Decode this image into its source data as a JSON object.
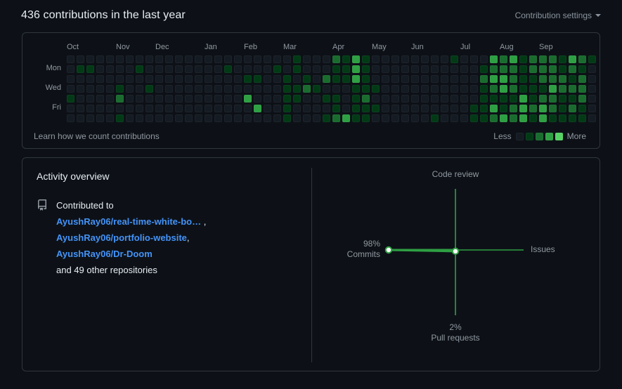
{
  "header": {
    "title": "436 contributions in the last year",
    "settings_label": "Contribution settings",
    "caret_icon": "chevron-down-icon"
  },
  "graph": {
    "months": [
      "Oct",
      "Nov",
      "Dec",
      "Jan",
      "Feb",
      "Mar",
      "Apr",
      "May",
      "Jun",
      "Jul",
      "Aug",
      "Sep"
    ],
    "month_week_index": [
      0,
      5,
      9,
      14,
      18,
      22,
      27,
      31,
      35,
      40,
      44,
      48
    ],
    "day_labels": [
      {
        "label": "Mon",
        "row": 1
      },
      {
        "label": "Wed",
        "row": 3
      },
      {
        "label": "Fri",
        "row": 5
      }
    ],
    "learn_link": "Learn how we count contributions",
    "legend": {
      "less": "Less",
      "more": "More",
      "colors": [
        "#151b23",
        "#033a16",
        "#196c2e",
        "#2ea043",
        "#56d364"
      ]
    },
    "palette": [
      "#151b23",
      "#033a16",
      "#196c2e",
      "#2ea043",
      "#56d364"
    ],
    "weeks": [
      [
        0,
        0,
        0,
        0,
        1,
        0,
        0
      ],
      [
        0,
        1,
        0,
        0,
        0,
        0,
        0
      ],
      [
        0,
        1,
        0,
        0,
        0,
        0,
        0
      ],
      [
        0,
        0,
        0,
        0,
        0,
        0,
        0
      ],
      [
        0,
        0,
        0,
        0,
        0,
        0,
        0
      ],
      [
        0,
        0,
        0,
        1,
        2,
        0,
        1
      ],
      [
        0,
        0,
        0,
        0,
        0,
        0,
        0
      ],
      [
        0,
        1,
        0,
        0,
        0,
        0,
        0
      ],
      [
        0,
        0,
        0,
        1,
        0,
        0,
        0
      ],
      [
        0,
        0,
        0,
        0,
        0,
        0,
        0
      ],
      [
        0,
        0,
        0,
        0,
        0,
        0,
        0
      ],
      [
        0,
        0,
        0,
        0,
        0,
        0,
        0
      ],
      [
        0,
        0,
        0,
        0,
        0,
        0,
        0
      ],
      [
        0,
        0,
        0,
        0,
        0,
        0,
        0
      ],
      [
        0,
        0,
        0,
        0,
        0,
        0,
        0
      ],
      [
        0,
        0,
        0,
        0,
        0,
        0,
        0
      ],
      [
        0,
        1,
        0,
        0,
        0,
        0,
        0
      ],
      [
        0,
        0,
        0,
        0,
        0,
        0,
        0
      ],
      [
        0,
        0,
        1,
        0,
        3,
        0,
        0
      ],
      [
        0,
        0,
        1,
        0,
        0,
        3,
        0
      ],
      [
        0,
        0,
        0,
        0,
        0,
        0,
        0
      ],
      [
        0,
        1,
        0,
        0,
        0,
        0,
        0
      ],
      [
        0,
        0,
        1,
        1,
        1,
        1,
        1
      ],
      [
        1,
        1,
        0,
        1,
        1,
        0,
        0
      ],
      [
        0,
        0,
        1,
        2,
        0,
        0,
        0
      ],
      [
        0,
        0,
        0,
        1,
        0,
        0,
        0
      ],
      [
        0,
        0,
        2,
        0,
        1,
        0,
        1
      ],
      [
        2,
        1,
        1,
        0,
        1,
        1,
        2
      ],
      [
        1,
        1,
        1,
        0,
        0,
        0,
        3
      ],
      [
        3,
        3,
        3,
        1,
        1,
        1,
        1
      ],
      [
        1,
        1,
        1,
        1,
        2,
        1,
        1
      ],
      [
        0,
        0,
        0,
        1,
        0,
        1,
        0
      ],
      [
        0,
        0,
        0,
        0,
        0,
        0,
        0
      ],
      [
        0,
        0,
        0,
        0,
        0,
        0,
        0
      ],
      [
        0,
        0,
        0,
        0,
        0,
        0,
        0
      ],
      [
        0,
        0,
        0,
        0,
        0,
        0,
        0
      ],
      [
        0,
        0,
        0,
        0,
        0,
        0,
        0
      ],
      [
        0,
        0,
        0,
        0,
        0,
        0,
        1
      ],
      [
        0,
        0,
        0,
        0,
        0,
        0,
        0
      ],
      [
        1,
        0,
        0,
        0,
        0,
        0,
        0
      ],
      [
        0,
        0,
        0,
        0,
        0,
        0,
        0
      ],
      [
        0,
        0,
        0,
        0,
        0,
        1,
        1
      ],
      [
        0,
        1,
        2,
        1,
        1,
        1,
        1
      ],
      [
        3,
        2,
        3,
        2,
        1,
        3,
        2
      ],
      [
        2,
        2,
        3,
        3,
        1,
        1,
        3
      ],
      [
        3,
        2,
        2,
        2,
        1,
        2,
        2
      ],
      [
        1,
        1,
        1,
        1,
        3,
        3,
        3
      ],
      [
        2,
        2,
        1,
        1,
        1,
        2,
        1
      ],
      [
        2,
        2,
        2,
        1,
        2,
        3,
        3
      ],
      [
        2,
        2,
        2,
        3,
        2,
        2,
        1
      ],
      [
        1,
        1,
        2,
        2,
        1,
        1,
        1
      ],
      [
        3,
        2,
        1,
        2,
        1,
        2,
        1
      ],
      [
        2,
        1,
        2,
        2,
        2,
        1,
        1
      ],
      [
        1,
        0,
        0,
        0,
        0,
        0,
        0
      ]
    ]
  },
  "activity": {
    "title": "Activity overview",
    "repo_icon": "repo-icon",
    "contributed_to": "Contributed to",
    "repos": [
      {
        "name": "AyushRay06/real-time-white-bo…",
        "sep": ","
      },
      {
        "name": "AyushRay06/portfolio-website",
        "sep": ","
      },
      {
        "name": "AyushRay06/Dr-Doom",
        "sep": ""
      }
    ],
    "other_text": "and 49 other repositories"
  },
  "chart_data": {
    "type": "radar",
    "title": "",
    "axes": [
      {
        "name": "Code review",
        "percent": null,
        "label_position": "top",
        "value": 0
      },
      {
        "name": "Issues",
        "percent": null,
        "label_position": "right",
        "value": 0
      },
      {
        "name": "Pull requests",
        "percent": "2%",
        "label_position": "bottom",
        "value": 2
      },
      {
        "name": "Commits",
        "percent": "98%",
        "label_position": "left",
        "value": 98
      }
    ],
    "series": [
      {
        "name": "activity",
        "values": [
          0,
          0,
          2,
          98
        ]
      }
    ],
    "axis_color": "#2ea043",
    "fill_color": "#2ea043",
    "point_color": "#ffffff",
    "ylim": [
      0,
      100
    ],
    "grid": false,
    "legend": "none"
  }
}
